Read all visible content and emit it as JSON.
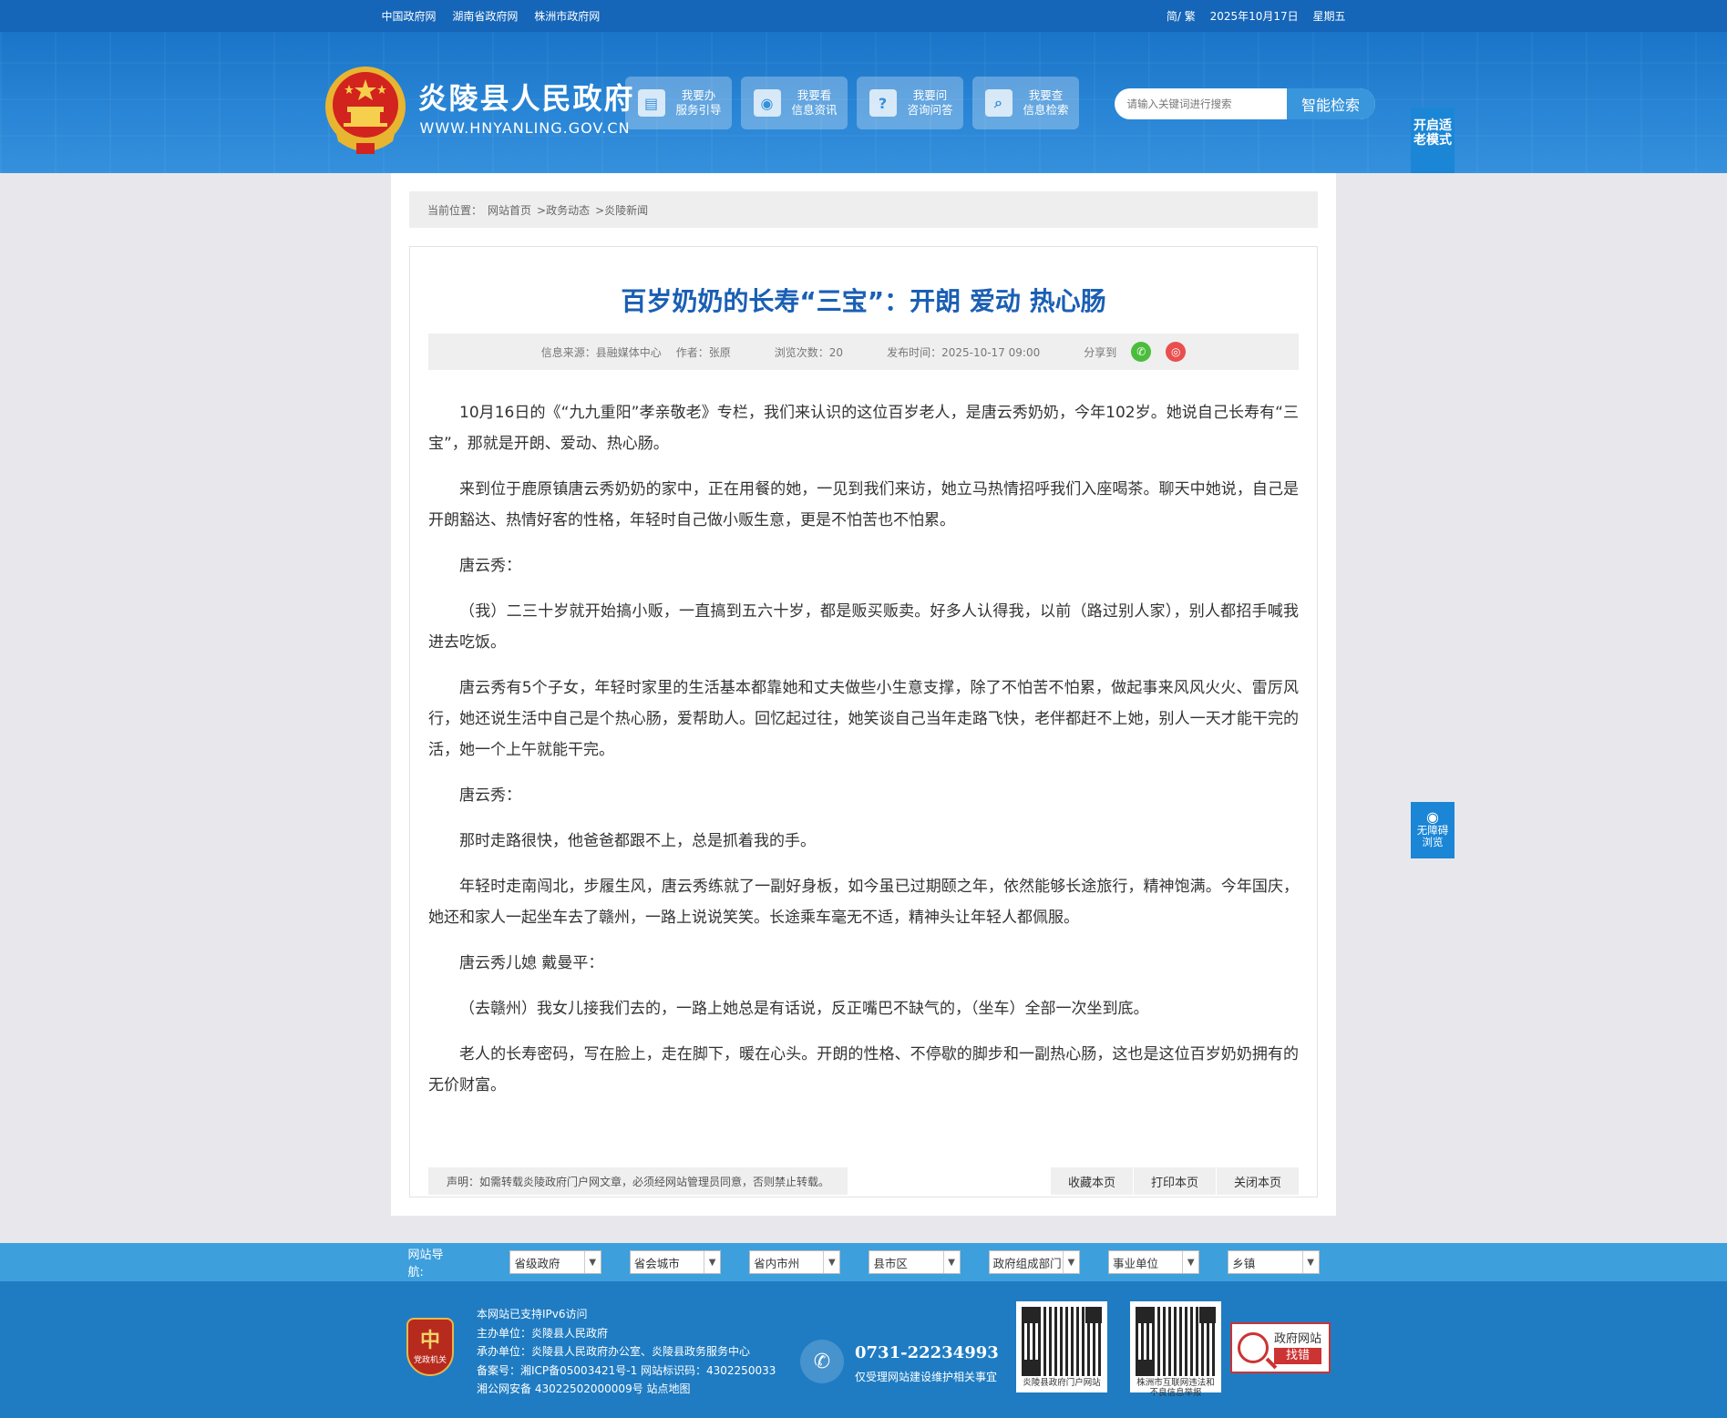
{
  "topbar": {
    "links": [
      "中国政府网",
      "湖南省政府网",
      "株洲市政府网"
    ],
    "lang": "简/ 繁",
    "date": "2025年10月17日",
    "weekday": "星期五"
  },
  "header": {
    "site_name": "炎陵县人民政府",
    "site_url": "WWW.HNYANLING.GOV.CN",
    "services": [
      {
        "line1": "我要办",
        "line2": "服务引导",
        "icon": "document-icon"
      },
      {
        "line1": "我要看",
        "line2": "信息资讯",
        "icon": "eye-icon"
      },
      {
        "line1": "我要问",
        "line2": "咨询问答",
        "icon": "question-icon"
      },
      {
        "line1": "我要查",
        "line2": "信息检索",
        "icon": "search-icon"
      }
    ],
    "search_placeholder": "请输入关键词进行搜索",
    "search_button": "智能检索",
    "elder_mode": "开启适老模式"
  },
  "breadcrumb": {
    "label": "当前位置：",
    "items": [
      "网站首页",
      ">政务动态",
      ">炎陵新闻"
    ]
  },
  "article": {
    "title": "百岁奶奶的长寿“三宝”：开朗 爱动 热心肠",
    "source": "信息来源：县融媒体中心",
    "author": "作者：张原",
    "views": "浏览次数：20",
    "published": "发布时间：2025-10-17 09:00",
    "share_label": "分享到",
    "paragraphs": [
      "10月16日的《“九九重阳”孝亲敬老》专栏，我们来认识的这位百岁老人，是唐云秀奶奶，今年102岁。她说自己长寿有“三宝”，那就是开朗、爱动、热心肠。",
      "来到位于鹿原镇唐云秀奶奶的家中，正在用餐的她，一见到我们来访，她立马热情招呼我们入座喝茶。聊天中她说，自己是开朗豁达、热情好客的性格，年轻时自己做小贩生意，更是不怕苦也不怕累。",
      " 唐云秀：",
      "（我）二三十岁就开始搞小贩，一直搞到五六十岁，都是贩买贩卖。好多人认得我，以前（路过别人家），别人都招手喊我进去吃饭。",
      "唐云秀有5个子女，年轻时家里的生活基本都靠她和丈夫做些小生意支撑，除了不怕苦不怕累，做起事来风风火火、雷厉风行，她还说生活中自己是个热心肠，爱帮助人。回忆起过往，她笑谈自己当年走路飞快，老伴都赶不上她，别人一天才能干完的活，她一个上午就能干完。",
      "唐云秀：",
      "那时走路很快，他爸爸都跟不上，总是抓着我的手。",
      "年轻时走南闯北，步履生风，唐云秀练就了一副好身板，如今虽已过期颐之年，依然能够长途旅行，精神饱满。今年国庆，她还和家人一起坐车去了赣州，一路上说说笑笑。长途乘车毫无不适，精神头让年轻人都佩服。",
      "唐云秀儿媳 戴曼平：",
      "（去赣州）我女儿接我们去的，一路上她总是有话说，反正嘴巴不缺气的，（坐车）全部一次坐到底。",
      "老人的长寿密码，写在脸上，走在脚下，暖在心头。开朗的性格、不停歇的脚步和一副热心肠，这也是这位百岁奶奶拥有的无价财富。"
    ],
    "notice": "声明：如需转载炎陵政府门户网文章，必须经网站管理员同意，否则禁止转载。",
    "actions": [
      "收藏本页",
      "打印本页",
      "关闭本页"
    ]
  },
  "accessibility": {
    "line1": "无障碍",
    "line2": "浏览"
  },
  "site_nav": {
    "label": "网站导航:",
    "selects": [
      "省级政府",
      "省会城市",
      "省内市州",
      "县市区",
      "政府组成部门",
      "事业单位",
      "乡镇"
    ]
  },
  "footer": {
    "badge_text": "党政机关",
    "info": [
      "本网站已支持IPv6访问",
      "主办单位：炎陵县人民政府",
      "承办单位：炎陵县人民政府办公室、炎陵县政务服务中心",
      "备案号：湘ICP备05003421号-1 网站标识码：4302250033",
      "湘公网安备 43022502000009号 站点地图"
    ],
    "phone": "0731-22234993",
    "phone_note": "仅受理网站建设维护相关事宜",
    "qr1_caption": "炎陵县政府门户网站",
    "qr2_caption": "株洲市互联网违法和不良信息举报",
    "find_error_top": "政府网站",
    "find_error_bottom": "找错"
  }
}
